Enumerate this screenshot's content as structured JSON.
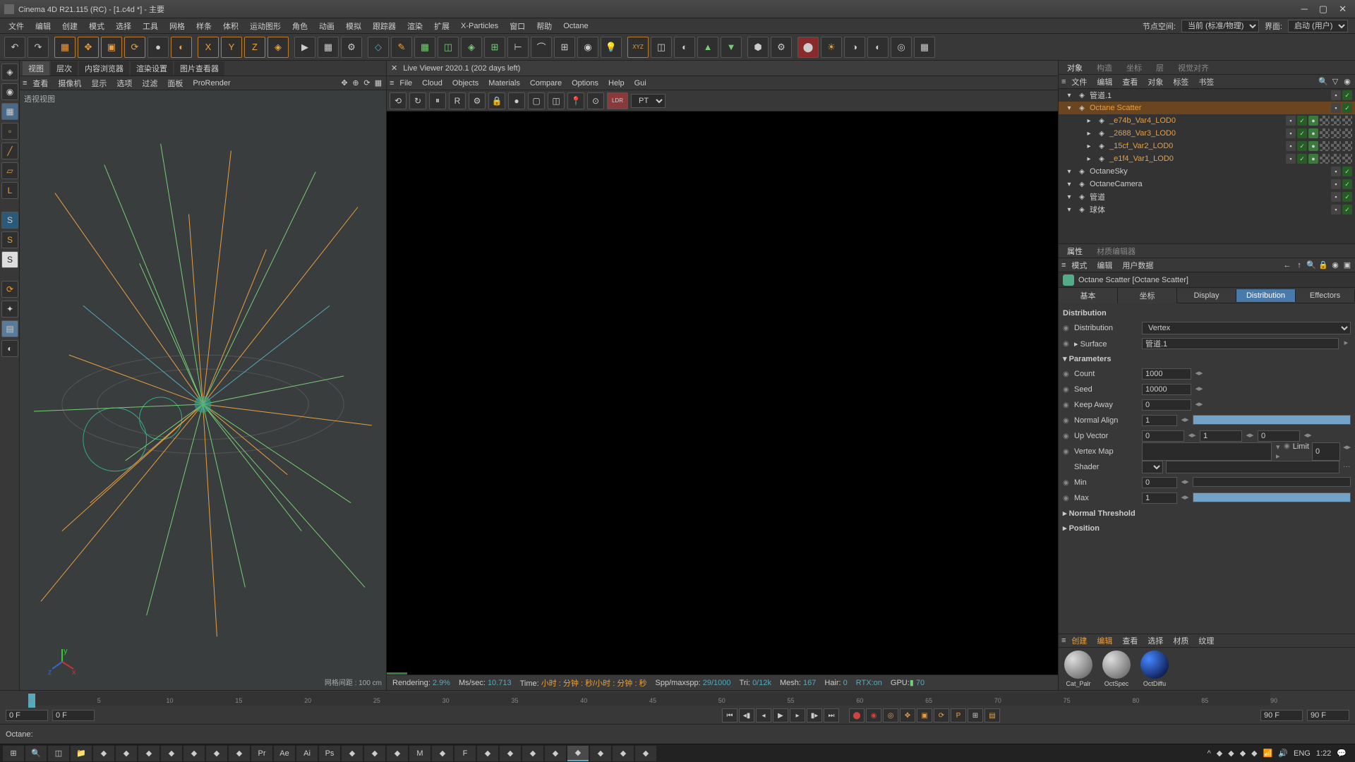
{
  "title": "Cinema 4D R21.115 (RC) - [1.c4d *] - 主要",
  "menubar": [
    "文件",
    "编辑",
    "创建",
    "模式",
    "选择",
    "工具",
    "网格",
    "样条",
    "体积",
    "运动图形",
    "角色",
    "动画",
    "模拟",
    "跟踪器",
    "渲染",
    "扩展",
    "X-Particles",
    "窗口",
    "帮助",
    "Octane"
  ],
  "menubar_right": {
    "node_space": "节点空间:",
    "node_val": "当前 (标准/物理)",
    "layout": "界面:",
    "layout_val": "启动 (用户)"
  },
  "rp_top_tabs": [
    "对象",
    "构造",
    "坐标",
    "层",
    "视觉对齐"
  ],
  "rp_menu": [
    "文件",
    "编辑",
    "查看",
    "对象",
    "标签",
    "书签"
  ],
  "objects": [
    {
      "name": "管道.1",
      "indent": 0,
      "orange": false
    },
    {
      "name": "Octane Scatter",
      "indent": 0,
      "orange": true,
      "sel": true
    },
    {
      "name": "_e74b_Var4_LOD0",
      "indent": 2,
      "orange": true,
      "tex": true
    },
    {
      "name": "_2688_Var3_LOD0",
      "indent": 2,
      "orange": true,
      "tex": true
    },
    {
      "name": "_15cf_Var2_LOD0",
      "indent": 2,
      "orange": true,
      "tex": true
    },
    {
      "name": "_e1f4_Var1_LOD0",
      "indent": 2,
      "orange": true,
      "tex": true
    },
    {
      "name": "OctaneSky",
      "indent": 0,
      "orange": false
    },
    {
      "name": "OctaneCamera",
      "indent": 0,
      "orange": false
    },
    {
      "name": "管道",
      "indent": 0,
      "orange": false
    },
    {
      "name": "球体",
      "indent": 0,
      "orange": false
    }
  ],
  "attr_tabs": [
    "属性",
    "材质编辑器"
  ],
  "attr_menu": [
    "模式",
    "编辑",
    "用户数据"
  ],
  "attr_title": "Octane Scatter [Octane Scatter]",
  "attr_subtabs": [
    "基本",
    "坐标",
    "Display",
    "Distribution",
    "Effectors"
  ],
  "dist": {
    "section": "Distribution",
    "distribution_lbl": "Distribution",
    "distribution_val": "Vertex",
    "surface_lbl": "Surface",
    "surface_val": "管道.1",
    "params": "Parameters",
    "count_lbl": "Count",
    "count_val": "1000",
    "seed_lbl": "Seed",
    "seed_val": "10000",
    "keep_lbl": "Keep Away",
    "keep_val": "0",
    "normal_lbl": "Normal Align",
    "normal_val": "1",
    "up_lbl": "Up Vector",
    "up_x": "0",
    "up_y": "1",
    "up_z": "0",
    "vmap_lbl": "Vertex Map",
    "limit_lbl": "Limit",
    "limit_val": "0",
    "shader_lbl": "Shader",
    "min_lbl": "Min",
    "min_val": "0",
    "max_lbl": "Max",
    "max_val": "1",
    "nthresh": "Normal Threshold",
    "position": "Position"
  },
  "mat_menu": [
    "创建",
    "编辑",
    "查看",
    "选择",
    "材质",
    "纹理"
  ],
  "materials": [
    {
      "name": "Cat_Palr"
    },
    {
      "name": "OctSpec"
    },
    {
      "name": "OctDiffu"
    }
  ],
  "vp_tabs": [
    "视图",
    "层次",
    "内容浏览器",
    "渲染设置",
    "图片查看器"
  ],
  "vp_menu": [
    "查看",
    "摄像机",
    "显示",
    "选项",
    "过滤",
    "面板",
    "ProRender"
  ],
  "vp_label": "透视视图",
  "vp_info": "网格间距 : 100 cm",
  "lv_title": "Live Viewer 2020.1 (202 days left)",
  "lv_menu": [
    "File",
    "Cloud",
    "Objects",
    "Materials",
    "Compare",
    "Options",
    "Help",
    "Gui"
  ],
  "lv_status": {
    "rendering": "Rendering:",
    "rendering_v": "2.9%",
    "mssec": "Ms/sec:",
    "mssec_v": "10.713",
    "time": "Time:",
    "time_v": "小时 : 分钟 : 秒/小时 : 分钟 : 秒",
    "spp": "Spp/maxspp:",
    "spp_v": "29/1000",
    "tri": "Tri:",
    "tri_v": "0/12k",
    "mesh": "Mesh:",
    "mesh_v": "167",
    "hair": "Hair:",
    "hair_v": "0",
    "rtx": "RTX:on",
    "gpu": "GPU:",
    "gpu_v": "70"
  },
  "timeline": {
    "start": "0 F",
    "start2": "0 F",
    "end": "90 F",
    "end2": "90 F",
    "ticks": [
      0,
      5,
      10,
      15,
      20,
      25,
      30,
      35,
      40,
      45,
      50,
      55,
      60,
      65,
      70,
      75,
      80,
      85,
      90
    ],
    "end_lbl": "0 F"
  },
  "status": "Octane:",
  "tray": {
    "lang": "ENG",
    "time": "1:22"
  }
}
